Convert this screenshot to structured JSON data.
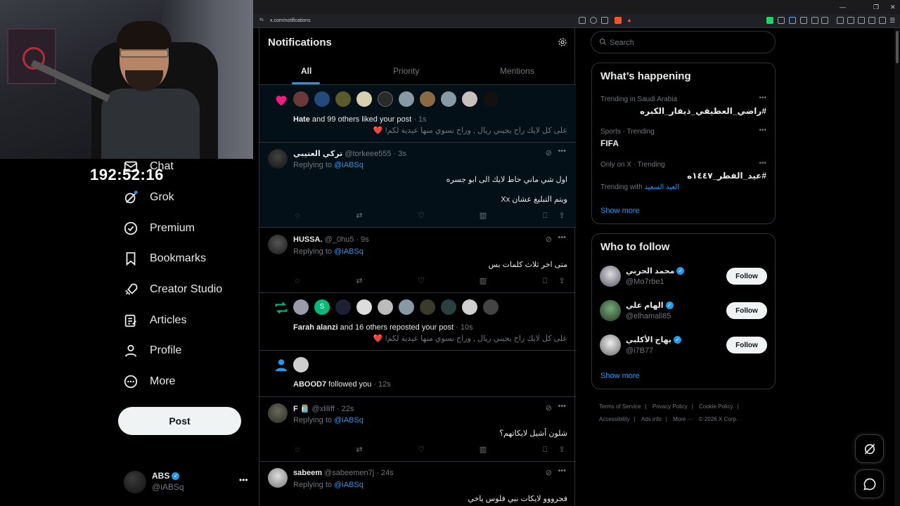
{
  "overlay": {
    "timer": "192:52:16"
  },
  "browser": {
    "url": "x.com/notifications"
  },
  "nav": {
    "items": [
      {
        "label": "Chat",
        "icon": "mail-icon"
      },
      {
        "label": "Grok",
        "icon": "grok-icon"
      },
      {
        "label": "Premium",
        "icon": "premium-icon"
      },
      {
        "label": "Bookmarks",
        "icon": "bookmark-icon"
      },
      {
        "label": "Creator Studio",
        "icon": "rocket-icon"
      },
      {
        "label": "Articles",
        "icon": "article-icon"
      },
      {
        "label": "Profile",
        "icon": "person-icon"
      },
      {
        "label": "More",
        "icon": "more-circle-icon"
      }
    ],
    "post_label": "Post",
    "account": {
      "name": "ABS",
      "handle": "@iABSq",
      "more": "•••"
    }
  },
  "main": {
    "title": "Notifications",
    "tabs": [
      "All",
      "Priority",
      "Mentions"
    ],
    "notifications": [
      {
        "type": "like",
        "text_bold": "Hate",
        "text": " and 99 others liked your post",
        "time": " · 1s",
        "quote": "على كل لايك راح يجيني ريال , وراح نسوي منها عيدية لكم! ❤️"
      },
      {
        "type": "reply",
        "name": "تركي العتيبي",
        "handle": "@torkeee555",
        "time": " · 3s",
        "replying": "Replying to ",
        "replying_to": "@iABSq",
        "line1": "اول شي ماني حاط لايك الى ابو جسره",
        "line2": "ويتم التبليغ عشان Xx"
      },
      {
        "type": "reply",
        "name": "HUSSA.",
        "handle": "@_0hu5",
        "time": " · 9s",
        "replying": "Replying to ",
        "replying_to": "@iABSq",
        "line1": "متى اخر ثلاث كلمات بس"
      },
      {
        "type": "repost",
        "text_bold": "Farah alanzi",
        "text": " and 16 others reposted your post",
        "time": " · 10s",
        "quote": "على كل لايك راح يجيني ريال , وراح نسوي منها عيدية لكم! ❤️"
      },
      {
        "type": "follow",
        "text_bold": "ABOOD7",
        "text": " followed you",
        "time": " · 12s"
      },
      {
        "type": "reply",
        "name": "F 🫙",
        "handle": "@xliliff",
        "time": " · 22s",
        "replying": "Replying to ",
        "replying_to": "@iABSq",
        "line1": "شلون أشيل لايكاتهم؟"
      },
      {
        "type": "reply",
        "name": "sabeem",
        "handle": "@sabeemen7j",
        "time": " · 24s",
        "replying": "Replying to ",
        "replying_to": "@iABSq",
        "line1": "فجرووو لايكات نبي فلوس ياخي"
      }
    ]
  },
  "sidebar": {
    "search_placeholder": "Search",
    "happening": {
      "title": "What’s happening",
      "trends": [
        {
          "meta": "Trending in Saudi Arabia",
          "name": "#راضي_العطيفي_ذيفار_الكبره"
        },
        {
          "meta": "Sports · Trending",
          "name": "FIFA"
        },
        {
          "meta": "Only on X · Trending",
          "name": "#عيد_الفطر_١٤٤٧ه",
          "with_label": "Trending with",
          "with_link": "العيد السعيد"
        }
      ],
      "show_more": "Show more"
    },
    "follow": {
      "title": "Who to follow",
      "users": [
        {
          "name": "محمد الحربي",
          "handle": "@Mo7rbe1",
          "button": "Follow"
        },
        {
          "name": "الهام علي",
          "handle": "@elhamali85",
          "button": "Follow"
        },
        {
          "name": "بهاج الأكلبي",
          "handle": "@i7B77",
          "button": "Follow"
        }
      ],
      "show_more": "Show more"
    },
    "footer": [
      "Terms of Service",
      "Privacy Policy",
      "Cookie Policy",
      "Accessibility",
      "Ads info",
      "More ···",
      "© 2026 X Corp."
    ]
  },
  "colors": {
    "accent": "#1d9bf0",
    "like": "#f91880",
    "repost": "#00ba7c"
  }
}
